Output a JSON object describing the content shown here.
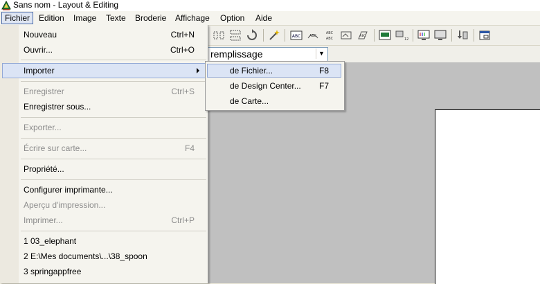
{
  "window": {
    "title": "Sans nom - Layout & Editing"
  },
  "menubar": {
    "items": [
      {
        "label": "Fichier"
      },
      {
        "label": "Edition"
      },
      {
        "label": "Image"
      },
      {
        "label": "Texte"
      },
      {
        "label": "Broderie"
      },
      {
        "label": "Affichage"
      },
      {
        "label": "Option"
      },
      {
        "label": "Aide"
      }
    ]
  },
  "fichier_menu": {
    "nouveau": {
      "label": "Nouveau",
      "shortcut": "Ctrl+N"
    },
    "ouvrir": {
      "label": "Ouvrir...",
      "shortcut": "Ctrl+O"
    },
    "importer": {
      "label": "Importer"
    },
    "enregistrer": {
      "label": "Enregistrer",
      "shortcut": "Ctrl+S"
    },
    "enregistrer_sous": {
      "label": "Enregistrer sous..."
    },
    "exporter": {
      "label": "Exporter..."
    },
    "ecrire_carte": {
      "label": "Écrire sur carte...",
      "shortcut": "F4"
    },
    "propriete": {
      "label": "Propriété..."
    },
    "configurer": {
      "label": "Configurer imprimante..."
    },
    "apercu": {
      "label": "Aperçu d'impression..."
    },
    "imprimer": {
      "label": "Imprimer...",
      "shortcut": "Ctrl+P"
    },
    "recent": [
      {
        "label": "1 03_elephant"
      },
      {
        "label": "2 E:\\Mes documents\\...\\38_spoon"
      },
      {
        "label": "3 springappfree"
      }
    ]
  },
  "importer_submenu": {
    "fichier": {
      "label": "de Fichier...",
      "shortcut": "F8"
    },
    "design_center": {
      "label": "de Design Center...",
      "shortcut": "F7"
    },
    "carte": {
      "label": "de Carte..."
    }
  },
  "toolbar": {
    "fill_combo": {
      "value": "remplissage"
    }
  },
  "colors": {
    "workspace": "#c0c0c0",
    "menu_highlight": "#dbe4f5",
    "menu_highlight_border": "#93a9d6"
  }
}
